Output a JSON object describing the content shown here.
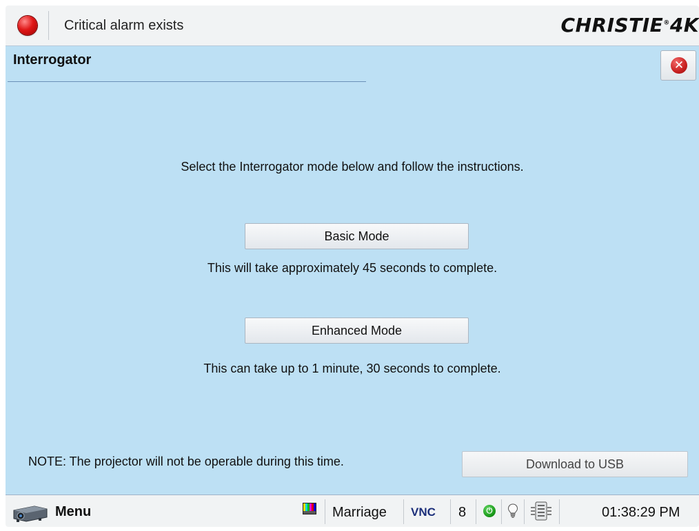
{
  "status": {
    "alarm_text": "Critical alarm exists",
    "alarm_color": "#e01818"
  },
  "brand": {
    "name": "CHRISTIE",
    "suffix": "4K"
  },
  "page": {
    "title": "Interrogator",
    "close_icon": "close-icon"
  },
  "main": {
    "instruction": "Select the Interrogator mode below and follow the instructions.",
    "basic_mode_label": "Basic Mode",
    "basic_mode_note": "This will take approximately 45 seconds to complete.",
    "enhanced_mode_label": "Enhanced Mode",
    "enhanced_mode_note": "This can take up to 1 minute, 30 seconds to complete.",
    "footer_note": "NOTE: The projector will not be operable during this time.",
    "usb_button_label": "Download to USB"
  },
  "taskbar": {
    "menu_label": "Menu",
    "menu_icon": "projector-icon",
    "source_icon": "test-pattern-icon",
    "source_name": "Marriage",
    "vnc_label": "VNC",
    "channel": "8",
    "power_icon": "power-icon",
    "lamp_icon": "lamp-icon",
    "network_icon": "network-icon",
    "time": "01:38:29 PM"
  },
  "colors": {
    "content_background": "#bde0f4",
    "power_green": "#1a9a1a",
    "vnc_blue": "#1c2f7a"
  }
}
